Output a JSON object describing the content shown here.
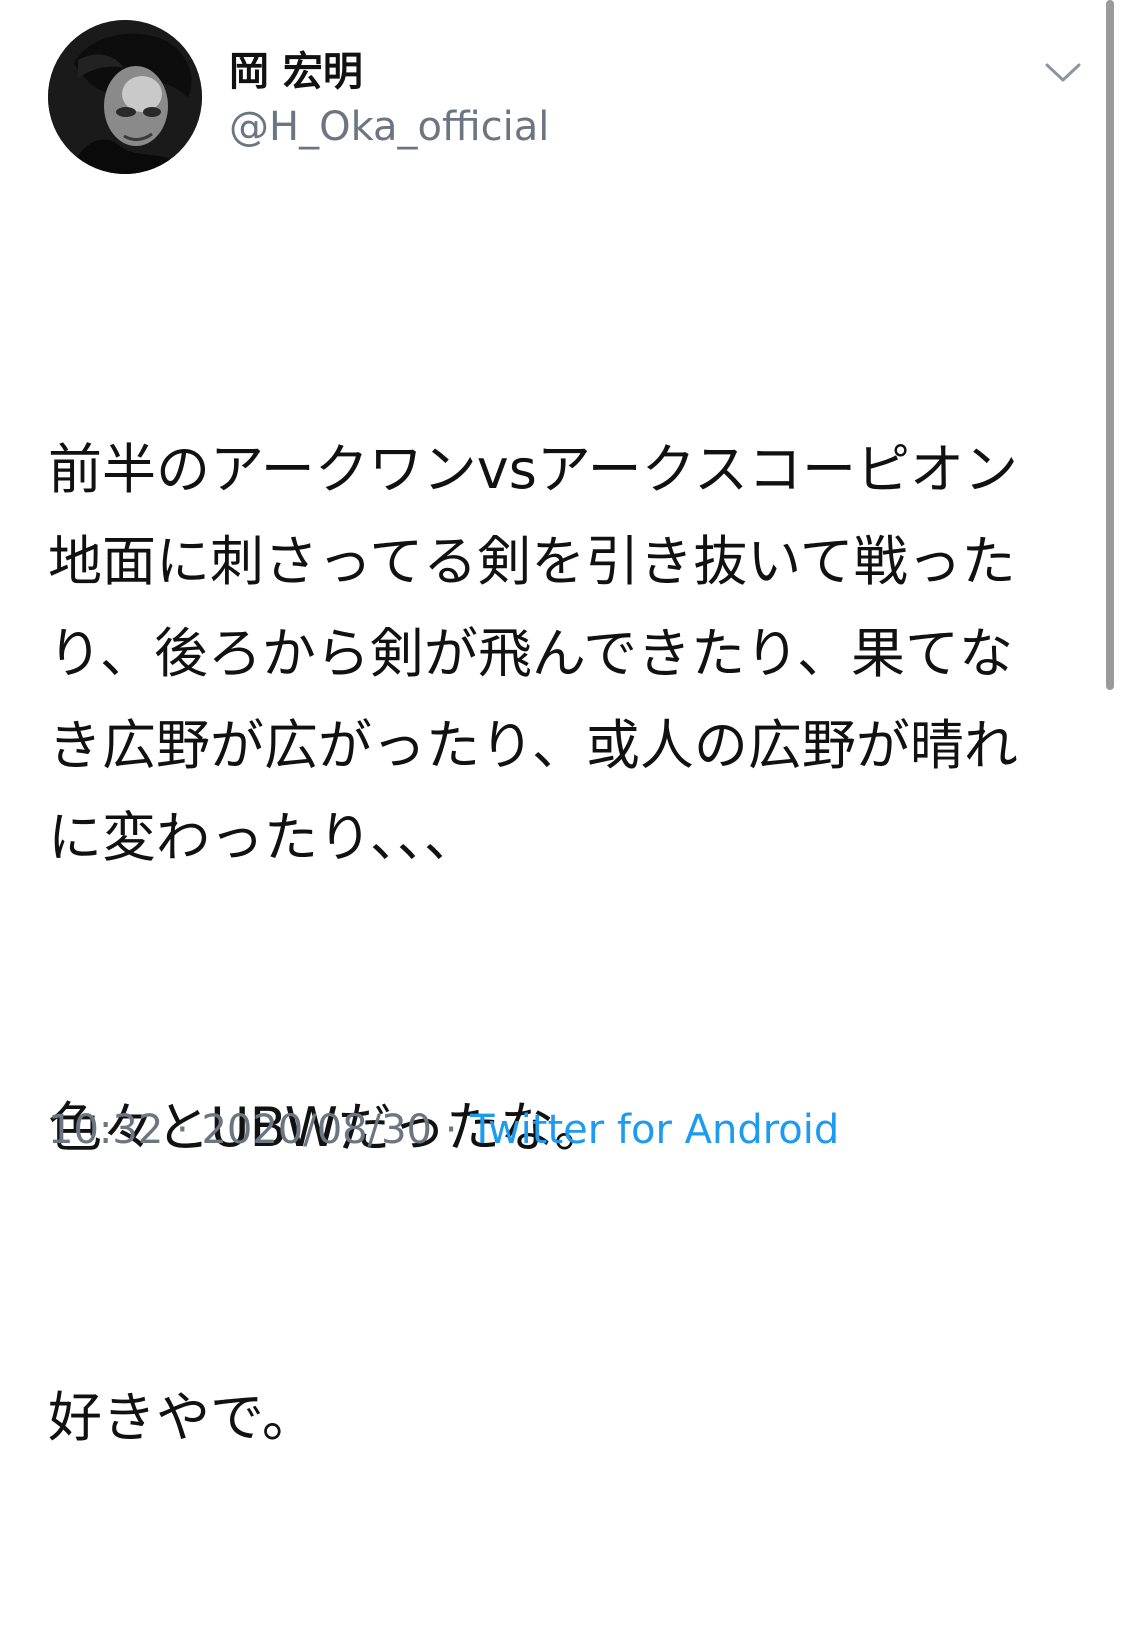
{
  "author": {
    "display_name": "岡 宏明",
    "handle": "@H_Oka_official"
  },
  "tweet": {
    "paragraphs": [
      "前半のアークワンvsアークスコーピオン\n地面に刺さってる剣を引き抜いて戦ったり、後ろから剣が飛んできたり、果てなき広野が広がったり、或人の広野が晴れに変わったり、、、",
      "色々とUBWだったな。",
      "好きやで。"
    ]
  },
  "meta": {
    "time": "10:32",
    "separator1": " · ",
    "date": "2020/08/30",
    "separator2": " · ",
    "source": "Twitter for Android"
  },
  "icons": {
    "avatar": "profile-photo",
    "more": "chevron-down-icon"
  },
  "colors": {
    "text": "#111111",
    "secondary": "#6b7682",
    "link": "#1d9bf0",
    "background": "#ffffff"
  }
}
